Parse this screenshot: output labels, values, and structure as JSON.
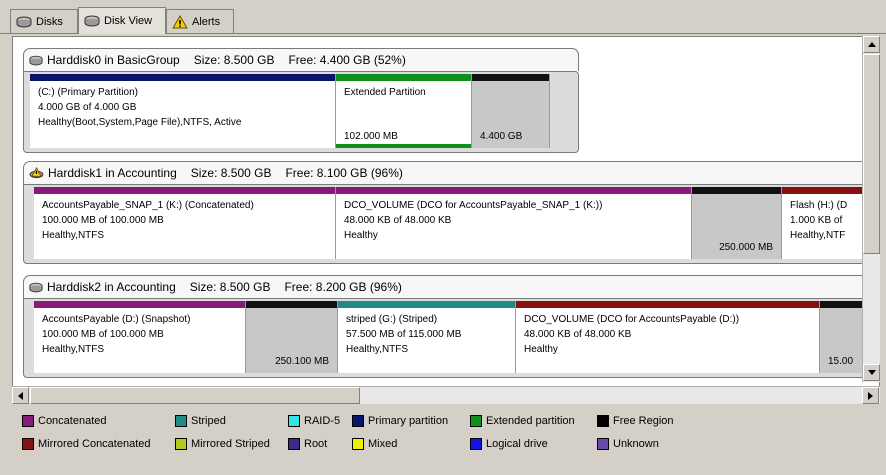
{
  "tabs": [
    {
      "label": "Disks",
      "icon": "disk-icon"
    },
    {
      "label": "Disk View",
      "icon": "disk-icon"
    },
    {
      "label": "Alerts",
      "icon": "warning-icon"
    }
  ],
  "colors": {
    "primary": "#0a146e",
    "extended": "#0e8f1e",
    "free": "#111111",
    "concatenated": "#8a1a7a",
    "striped": "#1e8a8a",
    "mirrored_concatenated": "#8a0f0f"
  },
  "disks": [
    {
      "name": "Harddisk0 in BasicGroup",
      "size": "Size: 8.500 GB",
      "free": "Free: 4.400 GB (52%)",
      "icon": "disk-icon",
      "volumes": [
        {
          "line1": "(C:) (Primary Partition)",
          "line2": "4.000 GB of 4.000 GB",
          "line3": "Healthy(Boot,System,Page File),NTFS, Active"
        },
        {
          "line1": "Extended Partition",
          "size": "102.000 MB"
        },
        {
          "size": "4.400 GB"
        }
      ]
    },
    {
      "name": "Harddisk1 in Accounting",
      "size": "Size: 8.500 GB",
      "free": "Free: 8.100 GB (96%)",
      "icon": "warning-disk-icon",
      "volumes": [
        {
          "line1": "AccountsPayable_SNAP_1 (K:) (Concatenated)",
          "line2": "100.000 MB of 100.000 MB",
          "line3": "Healthy,NTFS"
        },
        {
          "line1": "DCO_VOLUME (DCO for AccountsPayable_SNAP_1 (K:))",
          "line2": "48.000 KB of 48.000 KB",
          "line3": "Healthy"
        },
        {
          "size": "250.000 MB"
        },
        {
          "line1": "Flash (H:) (D",
          "line2": "1.000 KB of",
          "line3": "Healthy,NTF"
        }
      ]
    },
    {
      "name": "Harddisk2 in Accounting",
      "size": "Size: 8.500 GB",
      "free": "Free: 8.200 GB (96%)",
      "icon": "disk-icon",
      "volumes": [
        {
          "line1": "AccountsPayable (D:) (Snapshot)",
          "line2": "100.000 MB of 100.000 MB",
          "line3": "Healthy,NTFS"
        },
        {
          "size": "250.100 MB"
        },
        {
          "line1": "striped (G:) (Striped)",
          "line2": "57.500 MB of 115.000 MB",
          "line3": "Healthy,NTFS"
        },
        {
          "line1": "DCO_VOLUME (DCO for AccountsPayable (D:))",
          "line2": "48.000 KB of 48.000 KB",
          "line3": "Healthy"
        },
        {
          "size": "15.00"
        }
      ]
    }
  ],
  "legend": [
    {
      "label": "Concatenated",
      "color": "#8a1a7a"
    },
    {
      "label": "Striped",
      "color": "#1e8a8a"
    },
    {
      "label": "RAID-5",
      "color": "#2ee6e6"
    },
    {
      "label": "Primary partition",
      "color": "#0a146e"
    },
    {
      "label": "Extended partition",
      "color": "#0e8f1e"
    },
    {
      "label": "Free Region",
      "color": "#000000"
    },
    {
      "label": "Mirrored Concatenated",
      "color": "#8a0f0f"
    },
    {
      "label": "Mirrored Striped",
      "color": "#b4c81e"
    },
    {
      "label": "Root",
      "color": "#3a2a8a"
    },
    {
      "label": "Mixed",
      "color": "#f0f000"
    },
    {
      "label": "Logical drive",
      "color": "#1414e6"
    },
    {
      "label": "Unknown",
      "color": "#6a4aaa"
    }
  ]
}
